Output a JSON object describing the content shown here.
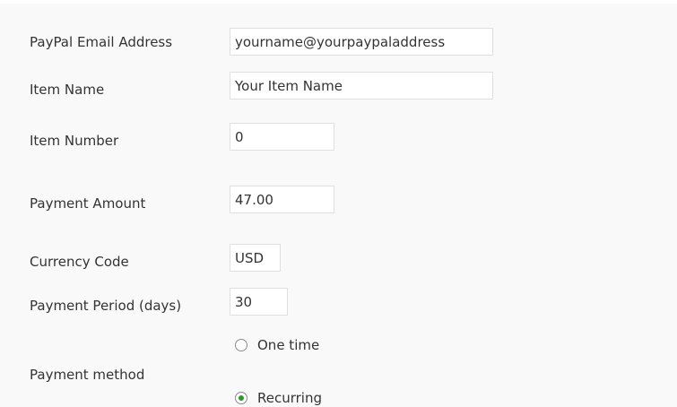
{
  "form": {
    "paypal_email": {
      "label": "PayPal Email Address",
      "value": "yourname@yourpaypaladdress"
    },
    "item_name": {
      "label": "Item Name",
      "value": "Your Item Name"
    },
    "item_number": {
      "label": "Item Number",
      "value": "0"
    },
    "payment_amount": {
      "label": "Payment Amount",
      "value": "47.00"
    },
    "currency_code": {
      "label": "Currency Code",
      "value": "USD"
    },
    "payment_period": {
      "label": "Payment Period (days)",
      "value": "30"
    },
    "payment_method": {
      "label": "Payment method",
      "options": [
        {
          "label": "One time",
          "selected": false
        },
        {
          "label": "Recurring",
          "selected": true
        }
      ]
    }
  },
  "colors": {
    "background": "#f9f9f9",
    "field_border": "#dfdfdf",
    "radio_selected": "#2a9a2a"
  }
}
